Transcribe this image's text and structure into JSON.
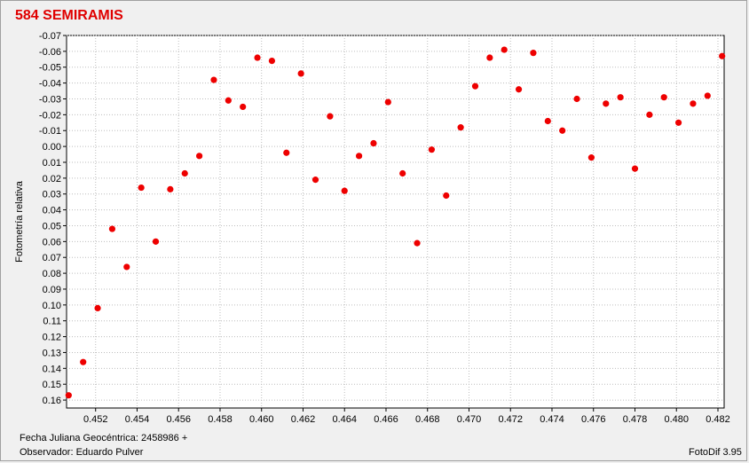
{
  "window": {
    "title": "584 SEMIRAMIS"
  },
  "footer": {
    "date_label": "Fecha Juliana Geocéntrica: 2458986 +",
    "observer": "Observador: Eduardo Pulver",
    "software": "FotoDif 3.95"
  },
  "colors": {
    "title": "#e00000",
    "points": "#ee0000",
    "grid": "#bdbdbd",
    "plot_bg": "#ffffff"
  },
  "chart_data": {
    "type": "scatter",
    "title": "584 SEMIRAMIS",
    "xlabel": "",
    "ylabel": "Fotometría relativa",
    "xlim": [
      0.4506,
      0.4823
    ],
    "ylim": [
      0.165,
      -0.07
    ],
    "y_inverted": true,
    "grid": true,
    "xticks": [
      0.452,
      0.454,
      0.456,
      0.458,
      0.46,
      0.462,
      0.464,
      0.466,
      0.468,
      0.47,
      0.472,
      0.474,
      0.476,
      0.478,
      0.48,
      0.482
    ],
    "xtick_labels": [
      "0.452",
      "0.454",
      "0.456",
      "0.458",
      "0.460",
      "0.462",
      "0.464",
      "0.466",
      "0.468",
      "0.470",
      "0.472",
      "0.474",
      "0.476",
      "0.478",
      "0.480",
      "0.482"
    ],
    "yticks": [
      -0.07,
      -0.06,
      -0.05,
      -0.04,
      -0.03,
      -0.02,
      -0.01,
      0.0,
      0.01,
      0.02,
      0.03,
      0.04,
      0.05,
      0.06,
      0.07,
      0.08,
      0.09,
      0.1,
      0.11,
      0.12,
      0.13,
      0.14,
      0.15,
      0.16
    ],
    "ytick_labels": [
      "-0.07",
      "-0.06",
      "-0.05",
      "-0.04",
      "-0.03",
      "-0.02",
      "-0.01",
      "0.00",
      "0.01",
      "0.02",
      "0.03",
      "0.04",
      "0.05",
      "0.06",
      "0.07",
      "0.08",
      "0.09",
      "0.10",
      "0.11",
      "0.12",
      "0.13",
      "0.14",
      "0.15",
      "0.16"
    ],
    "series": [
      {
        "x": [
          0.4507,
          0.4514,
          0.4521,
          0.4528,
          0.4535,
          0.4542,
          0.4549,
          0.4556,
          0.4563,
          0.457,
          0.4577,
          0.4584,
          0.4591,
          0.4598,
          0.4605,
          0.4612,
          0.4619,
          0.4626,
          0.4633,
          0.464,
          0.4647,
          0.4654,
          0.4661,
          0.4668,
          0.4675,
          0.4682,
          0.4689,
          0.4696,
          0.4703,
          0.471,
          0.4717,
          0.4724,
          0.4731,
          0.4738,
          0.4745,
          0.4752,
          0.4759,
          0.4766,
          0.4773,
          0.478,
          0.4787,
          0.4794,
          0.4801,
          0.4808,
          0.4815,
          0.4822
        ],
        "y": [
          0.157,
          0.136,
          0.102,
          0.052,
          0.076,
          0.026,
          0.06,
          0.027,
          0.017,
          0.006,
          -0.042,
          -0.029,
          -0.025,
          -0.056,
          -0.054,
          0.004,
          -0.046,
          0.021,
          -0.019,
          0.028,
          0.006,
          -0.002,
          -0.028,
          0.017,
          0.061,
          0.002,
          0.031,
          -0.012,
          -0.038,
          -0.056,
          -0.061,
          -0.036,
          -0.059,
          -0.016,
          -0.01,
          -0.03,
          0.007,
          -0.027,
          -0.031,
          0.014,
          -0.02,
          -0.031,
          -0.015,
          -0.027,
          -0.032,
          -0.057
        ]
      }
    ]
  }
}
